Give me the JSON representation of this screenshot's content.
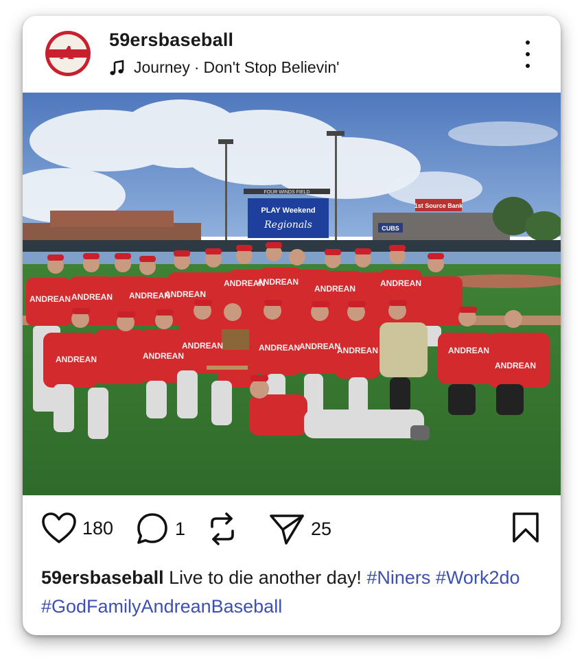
{
  "post": {
    "username": "59ersbaseball",
    "avatar_label": "ANDREAN 59ERS",
    "music": {
      "artist": "Journey",
      "separator": "·",
      "song": "Don't Stop Believin'"
    }
  },
  "actions": {
    "likes": "180",
    "comments": "1",
    "shares": "25"
  },
  "caption": {
    "username": "59ersbaseball",
    "text": "Live to die another day!",
    "hashtags": [
      "#Niners",
      "#Work2do",
      "#GodFamilyAndreanBaseball"
    ]
  },
  "photo": {
    "scoreboard_top": "FOUR WINDS FIELD",
    "scoreboard_line1": "PLAY Weekend",
    "scoreboard_line2": "Regionals",
    "jersey_text": "ANDREAN",
    "sign_cubs": "CUBS",
    "sign_bank": "1st Source Bank"
  },
  "colors": {
    "hashtag": "#3d4fb0",
    "jersey_red": "#d32a2e",
    "sky": "#5f86c4",
    "grass": "#3c7a35"
  },
  "icons": [
    "music-note-icon",
    "more-options-icon",
    "heart-icon",
    "comment-icon",
    "repost-icon",
    "share-icon",
    "bookmark-icon"
  ]
}
